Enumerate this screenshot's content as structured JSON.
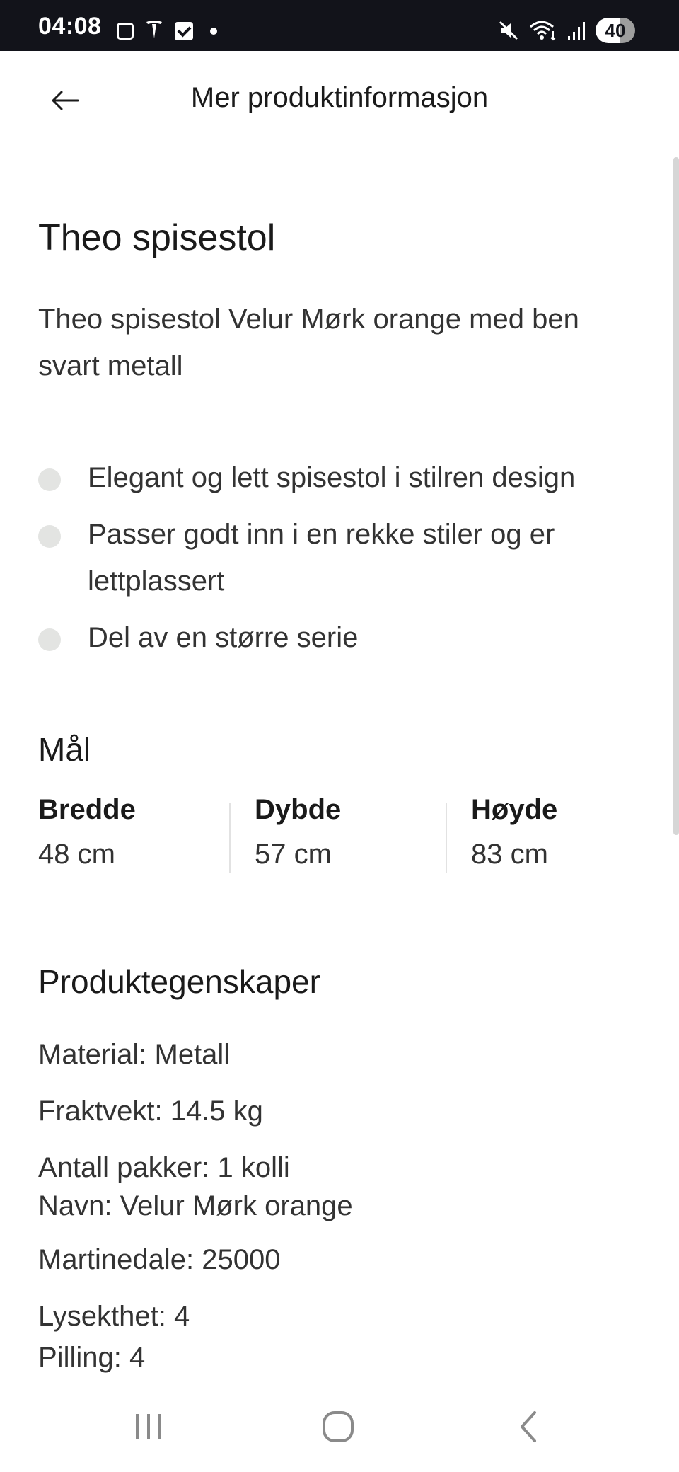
{
  "status_bar": {
    "time": "04:08",
    "battery": "40"
  },
  "header": {
    "title": "Mer produktinformasjon"
  },
  "product": {
    "title": "Theo spisestol",
    "subtitle": "Theo spisestol Velur Mørk orange med ben svart metall",
    "bullets": [
      "Elegant og lett spisestol i stilren design",
      "Passer godt inn i en rekke stiler og er lettplassert",
      "Del av en større serie"
    ]
  },
  "dimensions": {
    "heading": "Mål",
    "items": [
      {
        "label": "Bredde",
        "value": "48 cm"
      },
      {
        "label": "Dybde",
        "value": "57 cm"
      },
      {
        "label": "Høyde",
        "value": "83 cm"
      }
    ]
  },
  "properties": {
    "heading": "Produktegenskaper",
    "items": [
      "Material: Metall",
      "Fraktvekt: 14.5 kg",
      "Antall pakker: 1 kolli",
      "Navn: Velur Mørk orange",
      "Martinedale: 25000",
      "Lysekthet: 4"
    ],
    "cut_off": "Pilling: 4"
  }
}
